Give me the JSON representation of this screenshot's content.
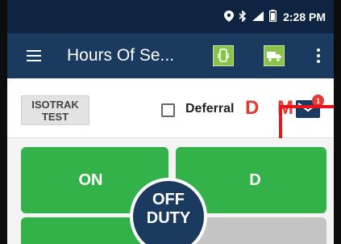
{
  "statusbar": {
    "time": "2:28 PM",
    "icons": [
      "location-icon",
      "bluetooth-icon",
      "signal-icon",
      "battery-icon"
    ]
  },
  "appbar": {
    "title": "Hours Of Se...",
    "icons": [
      "menu-icon",
      "phone-device-icon",
      "truck-icon",
      "more-vert-icon"
    ]
  },
  "toolbar": {
    "isotrak_line1": "ISOTRAK",
    "isotrak_line2": "TEST",
    "deferral_label": "Deferral",
    "deferral_checked": false,
    "dm_label": "D M",
    "mail_badge_count": "1"
  },
  "duty": {
    "on_label": "ON",
    "d_label": "D",
    "off_line1": "OFF",
    "off_line2": "DUTY"
  },
  "colors": {
    "statusbar": "#0f2440",
    "appbar": "#1b3a60",
    "accent_green": "#33b249",
    "alert_red": "#e53935",
    "highlight_box": "#e8141c"
  }
}
